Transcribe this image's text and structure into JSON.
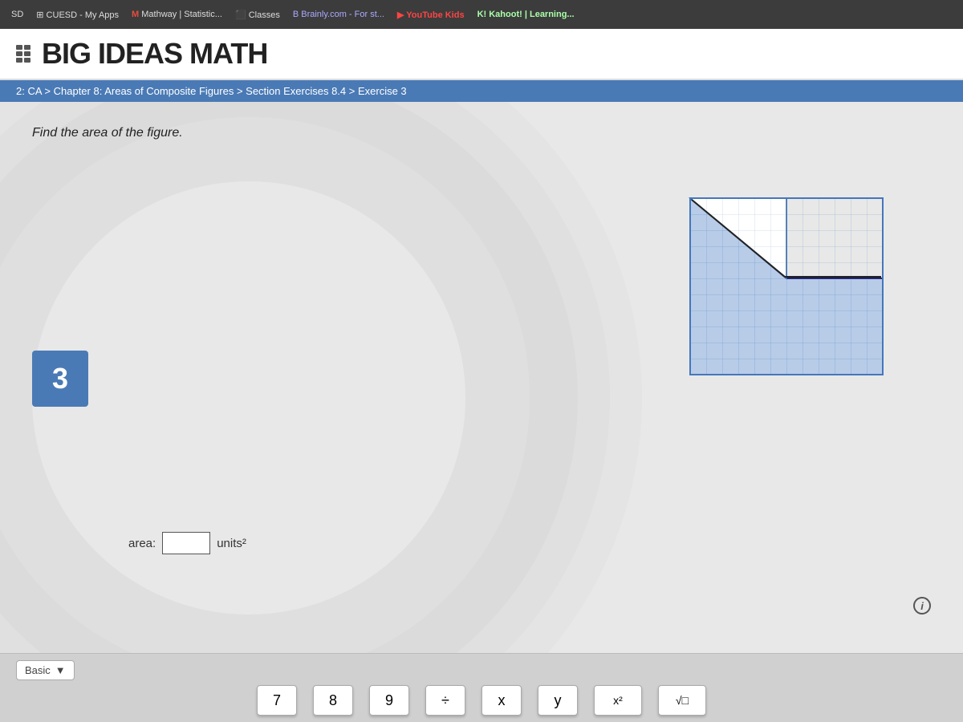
{
  "browser": {
    "tabs": [
      {
        "id": "sd",
        "label": "SD",
        "active": false
      },
      {
        "id": "cuesd",
        "label": "CUESD - My Apps",
        "active": false
      },
      {
        "id": "mathway",
        "label": "M  Mathway | Statistic...",
        "active": false
      },
      {
        "id": "classes",
        "label": "Classes",
        "active": false
      },
      {
        "id": "brainly",
        "label": "B  Brainly.com - For st...",
        "active": false
      },
      {
        "id": "youtube",
        "label": "YouTube Kids",
        "active": false,
        "style": "youtube"
      },
      {
        "id": "kahoot",
        "label": "K!  Kahoot! | Learning...",
        "active": false,
        "style": "kahoot"
      }
    ]
  },
  "header": {
    "site_title": "BIG IDEAS MATH"
  },
  "breadcrumb": {
    "text": "2: CA > Chapter 8: Areas of Composite Figures > Section Exercises 8.4 > Exercise 3"
  },
  "problem": {
    "instruction": "Find the area of the figure.",
    "exercise_number": "3"
  },
  "answer": {
    "label": "area:",
    "value": "",
    "unit": "units²"
  },
  "keyboard": {
    "mode_label": "Basic",
    "keys": [
      {
        "id": "7",
        "label": "7"
      },
      {
        "id": "8",
        "label": "8"
      },
      {
        "id": "9",
        "label": "9"
      },
      {
        "id": "divide",
        "label": "÷"
      },
      {
        "id": "x",
        "label": "x"
      },
      {
        "id": "y",
        "label": "y"
      },
      {
        "id": "x2",
        "label": "x²"
      },
      {
        "id": "sqrt",
        "label": "√□"
      }
    ]
  },
  "info": {
    "icon_label": "i"
  }
}
